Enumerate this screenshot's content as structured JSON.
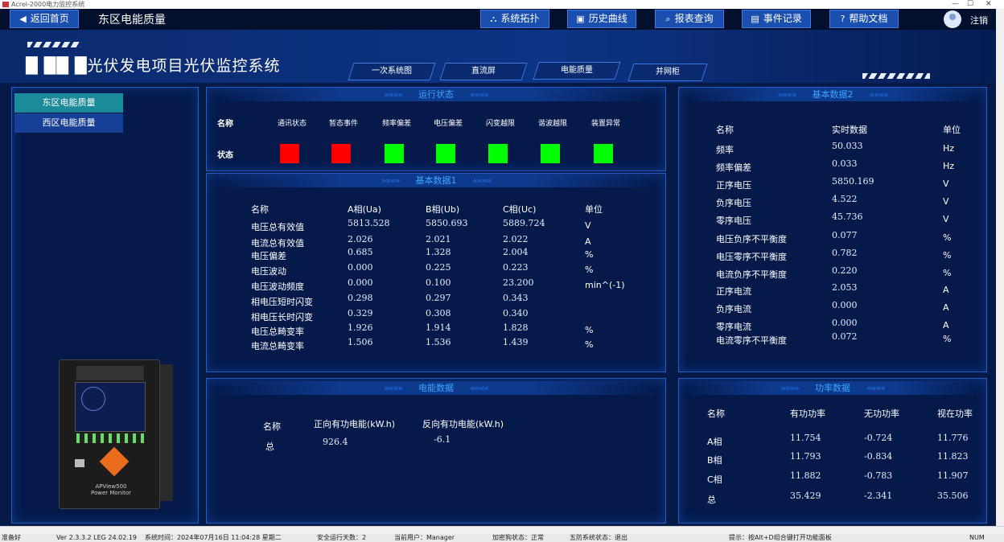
{
  "window": {
    "title": "Acrel-2000电力监控系统",
    "min": "—",
    "max": "☐",
    "close": "✕"
  },
  "topnav": {
    "home": "返回首页",
    "page_title": "东区电能质量",
    "topology": "系统拓扑",
    "history": "历史曲线",
    "report": "报表查询",
    "events": "事件记录",
    "help": "帮助文档",
    "logout": "注销"
  },
  "header": {
    "system_title": "█ ██ █光伏发电项目光伏监控系统",
    "tabs": [
      "一次系统图",
      "直流屏",
      "电能质量",
      "并网柜"
    ]
  },
  "sidebar": {
    "items": [
      "东区电能质量",
      "西区电能质量"
    ],
    "device_model": "APView500",
    "device_sub": "Power Monitor"
  },
  "run_status": {
    "title": "运行状态",
    "name_label": "名称",
    "state_label": "状态",
    "items": [
      {
        "label": "通讯状态",
        "color": "#ff0000"
      },
      {
        "label": "暂态事件",
        "color": "#ff0000"
      },
      {
        "label": "频率偏差",
        "color": "#00ff00"
      },
      {
        "label": "电压偏差",
        "color": "#00ff00"
      },
      {
        "label": "闪变越限",
        "color": "#00ff00"
      },
      {
        "label": "谐波越限",
        "color": "#00ff00"
      },
      {
        "label": "装置异常",
        "color": "#00ff00"
      }
    ]
  },
  "basic1": {
    "title": "基本数据1",
    "headers": [
      "名称",
      "A相(Ua)",
      "B相(Ub)",
      "C相(Uc)",
      "单位"
    ],
    "rows": [
      [
        "电压总有效值",
        "5813.528",
        "5850.693",
        "5889.724",
        "V"
      ],
      [
        "电流总有效值",
        "2.026",
        "2.021",
        "2.022",
        "A"
      ],
      [
        "电压偏差",
        "0.685",
        "1.328",
        "2.004",
        "%"
      ],
      [
        "电压波动",
        "0.000",
        "0.225",
        "0.223",
        "%"
      ],
      [
        "电压波动频度",
        "0.000",
        "0.100",
        "23.200",
        "min^(-1)"
      ],
      [
        "相电压短时闪变",
        "0.298",
        "0.297",
        "0.343",
        ""
      ],
      [
        "相电压长时闪变",
        "0.329",
        "0.308",
        "0.340",
        ""
      ],
      [
        "电压总畸变率",
        "1.926",
        "1.914",
        "1.828",
        "%"
      ],
      [
        "电流总畸变率",
        "1.506",
        "1.536",
        "1.439",
        "%"
      ]
    ]
  },
  "basic2": {
    "title": "基本数据2",
    "headers": [
      "名称",
      "实时数据",
      "单位"
    ],
    "rows": [
      [
        "频率",
        "50.033",
        "Hz"
      ],
      [
        "频率偏差",
        "0.033",
        "Hz"
      ],
      [
        "正序电压",
        "5850.169",
        "V"
      ],
      [
        "负序电压",
        "4.522",
        "V"
      ],
      [
        "零序电压",
        "45.736",
        "V"
      ],
      [
        "电压负序不平衡度",
        "0.077",
        "%"
      ],
      [
        "电压零序不平衡度",
        "0.782",
        "%"
      ],
      [
        "电流负序不平衡度",
        "0.220",
        "%"
      ],
      [
        "正序电流",
        "2.053",
        "A"
      ],
      [
        "负序电流",
        "0.000",
        "A"
      ],
      [
        "零序电流",
        "0.000",
        "A"
      ],
      [
        "电流零序不平衡度",
        "0.072",
        "%"
      ]
    ]
  },
  "energy": {
    "title": "电能数据",
    "headers": [
      "名称",
      "正向有功电能(kW.h)",
      "反向有功电能(kW.h)"
    ],
    "row": [
      "总",
      "926.4",
      "-6.1"
    ]
  },
  "power": {
    "title": "功率数据",
    "headers": [
      "名称",
      "有功功率",
      "无功功率",
      "视在功率"
    ],
    "rows": [
      [
        "A相",
        "11.754",
        "-0.724",
        "11.776"
      ],
      [
        "B相",
        "11.793",
        "-0.834",
        "11.823"
      ],
      [
        "C相",
        "11.882",
        "-0.783",
        "11.907"
      ],
      [
        "总",
        "35.429",
        "-2.341",
        "35.506"
      ]
    ]
  },
  "statusbar": {
    "ready": "准备好",
    "version": "Ver 2.3.3.2 LEG 24.02.19",
    "time": "系统时间：2024年07月16日 11:04:28 星期二",
    "safe_days": "安全运行天数：2",
    "user": "当前用户：Manager",
    "dog": "加密狗状态：正常",
    "five": "五防系统状态：退出",
    "tip": "提示：按Alt+D组合键打开功能面板",
    "num": "NUM"
  }
}
